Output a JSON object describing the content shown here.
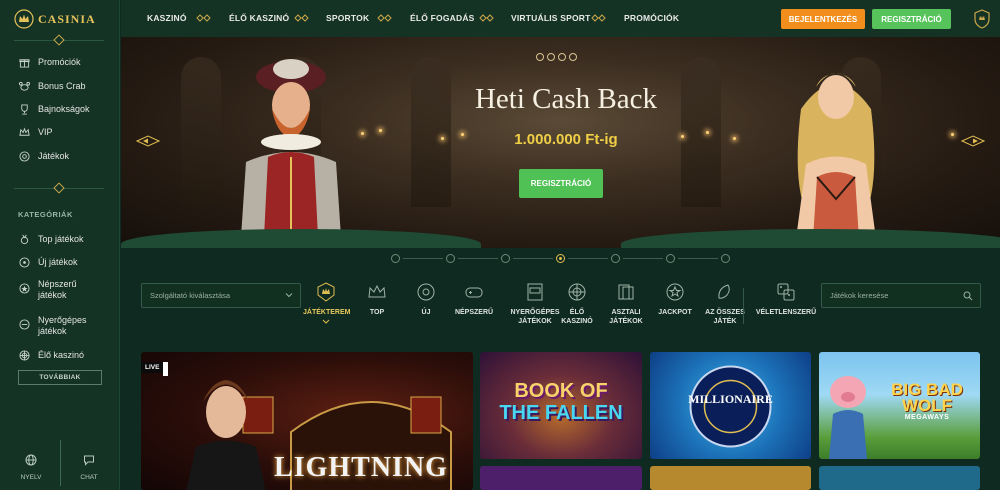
{
  "brand": {
    "name": "CASINIA"
  },
  "sidebar": {
    "items": [
      {
        "label": "Promóciók",
        "icon": "gift-icon"
      },
      {
        "label": "Bonus Crab",
        "icon": "crab-icon"
      },
      {
        "label": "Bajnokságok",
        "icon": "trophy-icon"
      },
      {
        "label": "VIP",
        "icon": "crown-icon"
      },
      {
        "label": "Játékok",
        "icon": "chip-icon"
      }
    ],
    "categories_title": "KATEGÓRIÁK",
    "categories": [
      {
        "label": "Top játékok",
        "icon": "medal-icon"
      },
      {
        "label": "Új játékok",
        "icon": "spark-icon"
      },
      {
        "label": "Népszerű játékok",
        "icon": "star-icon"
      },
      {
        "label": "Nyerőgépes játékok",
        "icon": "slot-icon"
      },
      {
        "label": "Élő kaszinó",
        "icon": "roulette-icon"
      }
    ],
    "more_button": "TOVÁBBIAK",
    "bottom": {
      "language": "NYELV",
      "chat": "CHAT"
    }
  },
  "topnav": {
    "items": [
      "KASZINÓ",
      "ÉLŐ KASZINÓ",
      "SPORTOK",
      "ÉLŐ FOGADÁS",
      "VIRTUÁLIS SPORT",
      "PROMÓCIÓK"
    ],
    "login": "BEJELENTKEZÉS",
    "register": "REGISZTRÁCIÓ"
  },
  "hero": {
    "title": "Heti Cash Back",
    "subtitle": "1.000.000 Ft-ig",
    "button": "REGISZTRÁCIÓ",
    "slides_count": 7,
    "active_slide": 3
  },
  "filters": {
    "provider_placeholder": "Szolgáltató kiválasztása",
    "search_placeholder": "Játékok keresése",
    "categories": [
      {
        "label": "JÁTÉKTEREM",
        "icon": "lobby-icon",
        "active": true
      },
      {
        "label": "TOP",
        "icon": "crown-icon"
      },
      {
        "label": "ÚJ",
        "icon": "new-icon"
      },
      {
        "label": "NÉPSZERŰ",
        "icon": "gamepad-icon"
      },
      {
        "label": "NYERŐGÉPES JÁTÉKOK",
        "icon": "slot-machine-icon"
      },
      {
        "label": "ÉLŐ KASZINÓ",
        "icon": "roulette-wheel-icon"
      },
      {
        "label": "ASZTALI JÁTÉKOK",
        "icon": "cards-icon"
      },
      {
        "label": "JACKPOT",
        "icon": "jackpot-icon"
      },
      {
        "label": "AZ ÖSSZES JÁTÉK",
        "icon": "all-games-icon"
      },
      {
        "label": "VÉLETLENSZERŰ",
        "icon": "dice-icon"
      }
    ]
  },
  "games": [
    {
      "title": "LIGHTNING",
      "badge": "LIVE"
    },
    {
      "title_line1": "BOOK OF",
      "title_line2": "THE FALLEN"
    },
    {
      "title": "MILLIONAIRE"
    },
    {
      "title_line1": "BIG BAD WOLF",
      "title_line2": "MEGAWAYS"
    }
  ],
  "colors": {
    "accent_gold": "#e0bd52",
    "login_orange": "#f28e1c",
    "register_green": "#57c45b",
    "bg_dark": "#0f2a20"
  }
}
